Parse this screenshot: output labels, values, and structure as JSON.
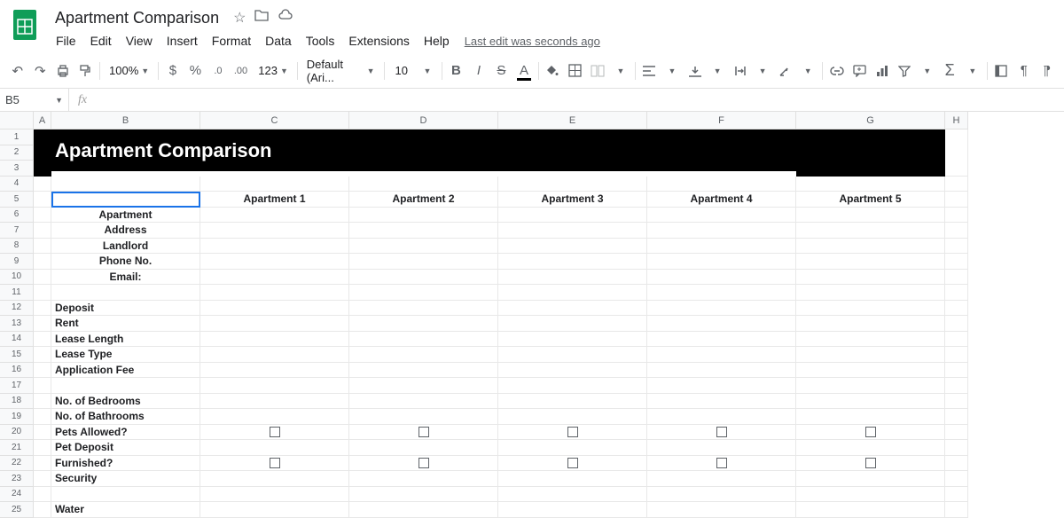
{
  "doc": {
    "title": "Apartment Comparison"
  },
  "menu": {
    "file": "File",
    "edit": "Edit",
    "view": "View",
    "insert": "Insert",
    "format": "Format",
    "data": "Data",
    "tools": "Tools",
    "extensions": "Extensions",
    "help": "Help",
    "last_edit": "Last edit was seconds ago"
  },
  "toolbar": {
    "zoom": "100%",
    "currency": "$",
    "percent": "%",
    "dec_dec": ".0",
    "inc_dec": ".00",
    "more_fmt": "123",
    "font": "Default (Ari...",
    "size": "10",
    "bold": "B",
    "italic": "I",
    "strike": "S",
    "text_color": "A"
  },
  "fx": {
    "cell_ref": "B5",
    "formula": ""
  },
  "columns": [
    "A",
    "B",
    "C",
    "D",
    "E",
    "F",
    "G",
    "H"
  ],
  "sheet": {
    "title": "Apartment Comparison",
    "col_headers": [
      "Apartment 1",
      "Apartment 2",
      "Apartment 3",
      "Apartment 4",
      "Apartment 5"
    ],
    "labels": {
      "apartment": "Apartment",
      "address": "Address",
      "landlord": "Landlord",
      "phone": "Phone No.",
      "email": "Email:",
      "deposit": "Deposit",
      "rent": "Rent",
      "lease_length": "Lease Length",
      "lease_type": "Lease Type",
      "app_fee": "Application Fee",
      "bedrooms": "No. of Bedrooms",
      "bathrooms": "No. of Bathrooms",
      "pets": "Pets Allowed?",
      "pet_deposit": "Pet Deposit",
      "furnished": "Furnished?",
      "security": "Security",
      "water": "Water"
    }
  }
}
